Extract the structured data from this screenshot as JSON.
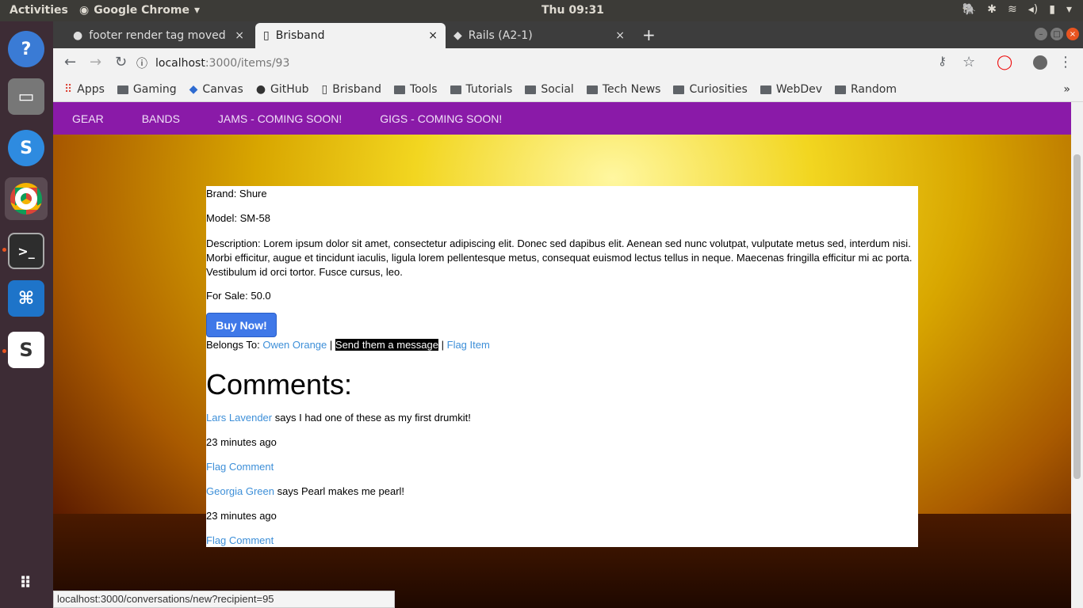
{
  "topbar": {
    "activities": "Activities",
    "app_name": "Google Chrome",
    "clock": "Thu 09:31"
  },
  "tabs": [
    {
      "title": "footer render tag moved",
      "close": "×"
    },
    {
      "title": "Brisband",
      "close": "×"
    },
    {
      "title": "Rails (A2-1)",
      "close": "×"
    }
  ],
  "newtab": "+",
  "address": {
    "host": "localhost",
    "rest": ":3000/items/93"
  },
  "bookmarks": [
    "Apps",
    "Gaming",
    "Canvas",
    "GitHub",
    "Brisband",
    "Tools",
    "Tutorials",
    "Social",
    "Tech News",
    "Curiosities",
    "WebDev",
    "Random"
  ],
  "bookmarks_more": "»",
  "nav": {
    "gear": "GEAR",
    "bands": "BANDS",
    "jams": "JAMS - COMING SOON!",
    "gigs": "GIGS - COMING SOON!"
  },
  "item": {
    "brand": "Brand: Shure",
    "model": "Model: SM-58",
    "description": "Description: Lorem ipsum dolor sit amet, consectetur adipiscing elit. Donec sed dapibus elit. Aenean sed nunc volutpat, vulputate metus sed, interdum nisi. Morbi efficitur, augue et tincidunt iaculis, ligula lorem pellentesque metus, consequat euismod lectus tellus in neque. Maecenas fringilla efficitur mi ac porta. Vestibulum id orci tortor. Fusce cursus, leo.",
    "for_sale": "For Sale: 50.0",
    "buy": "Buy Now!",
    "belongs_label": "Belongs To:",
    "owner": "Owen Orange",
    "sep": "|",
    "message": "Send them a message",
    "flag_item": "Flag Item"
  },
  "comments_heading": "Comments:",
  "comments": [
    {
      "user": "Lars Lavender",
      "text": "says I had one of these as my first drumkit!",
      "time": "23 minutes ago",
      "flag": "Flag Comment"
    },
    {
      "user": "Georgia Green",
      "text": "says Pearl makes me pearl!",
      "time": "23 minutes ago",
      "flag": "Flag Comment"
    }
  ],
  "status_url": "localhost:3000/conversations/new?recipient=95"
}
